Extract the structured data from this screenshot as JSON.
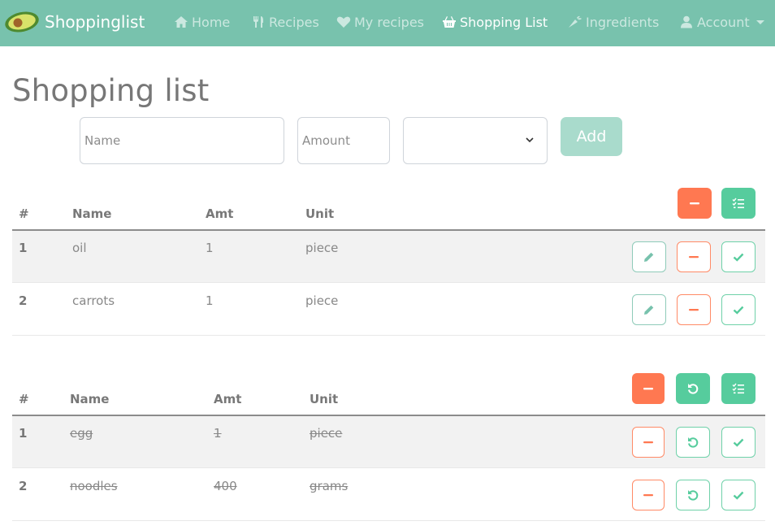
{
  "navbar": {
    "brand": "Shoppinglist",
    "items": [
      {
        "label": "Home",
        "icon": "home-icon"
      },
      {
        "label": "Recipes",
        "icon": "utensils-icon"
      },
      {
        "label": "My recipes",
        "icon": "heart-icon"
      },
      {
        "label": "Shopping List",
        "icon": "basket-icon",
        "active": true
      },
      {
        "label": "Ingredients",
        "icon": "carrot-icon"
      },
      {
        "label": "Account",
        "icon": "user-icon"
      }
    ]
  },
  "page": {
    "title": "Shopping list"
  },
  "form": {
    "name_placeholder": "Name",
    "amount_placeholder": "Amount",
    "unit_value": "",
    "add_label": "Add"
  },
  "table_open": {
    "headers": [
      "#",
      "Name",
      "Amt",
      "Unit"
    ],
    "rows": [
      {
        "index": "1",
        "name": "oil",
        "amount": "1",
        "unit": "piece"
      },
      {
        "index": "2",
        "name": "carrots",
        "amount": "1",
        "unit": "piece"
      }
    ]
  },
  "table_done": {
    "headers": [
      "#",
      "Name",
      "Amt",
      "Unit"
    ],
    "rows": [
      {
        "index": "1",
        "name": "egg",
        "amount": "1",
        "unit": "piece"
      },
      {
        "index": "2",
        "name": "noodles",
        "amount": "400",
        "unit": "grams"
      }
    ]
  },
  "colors": {
    "primary": "#78c2ad",
    "danger": "#ff7851",
    "success": "#56cc9d"
  }
}
